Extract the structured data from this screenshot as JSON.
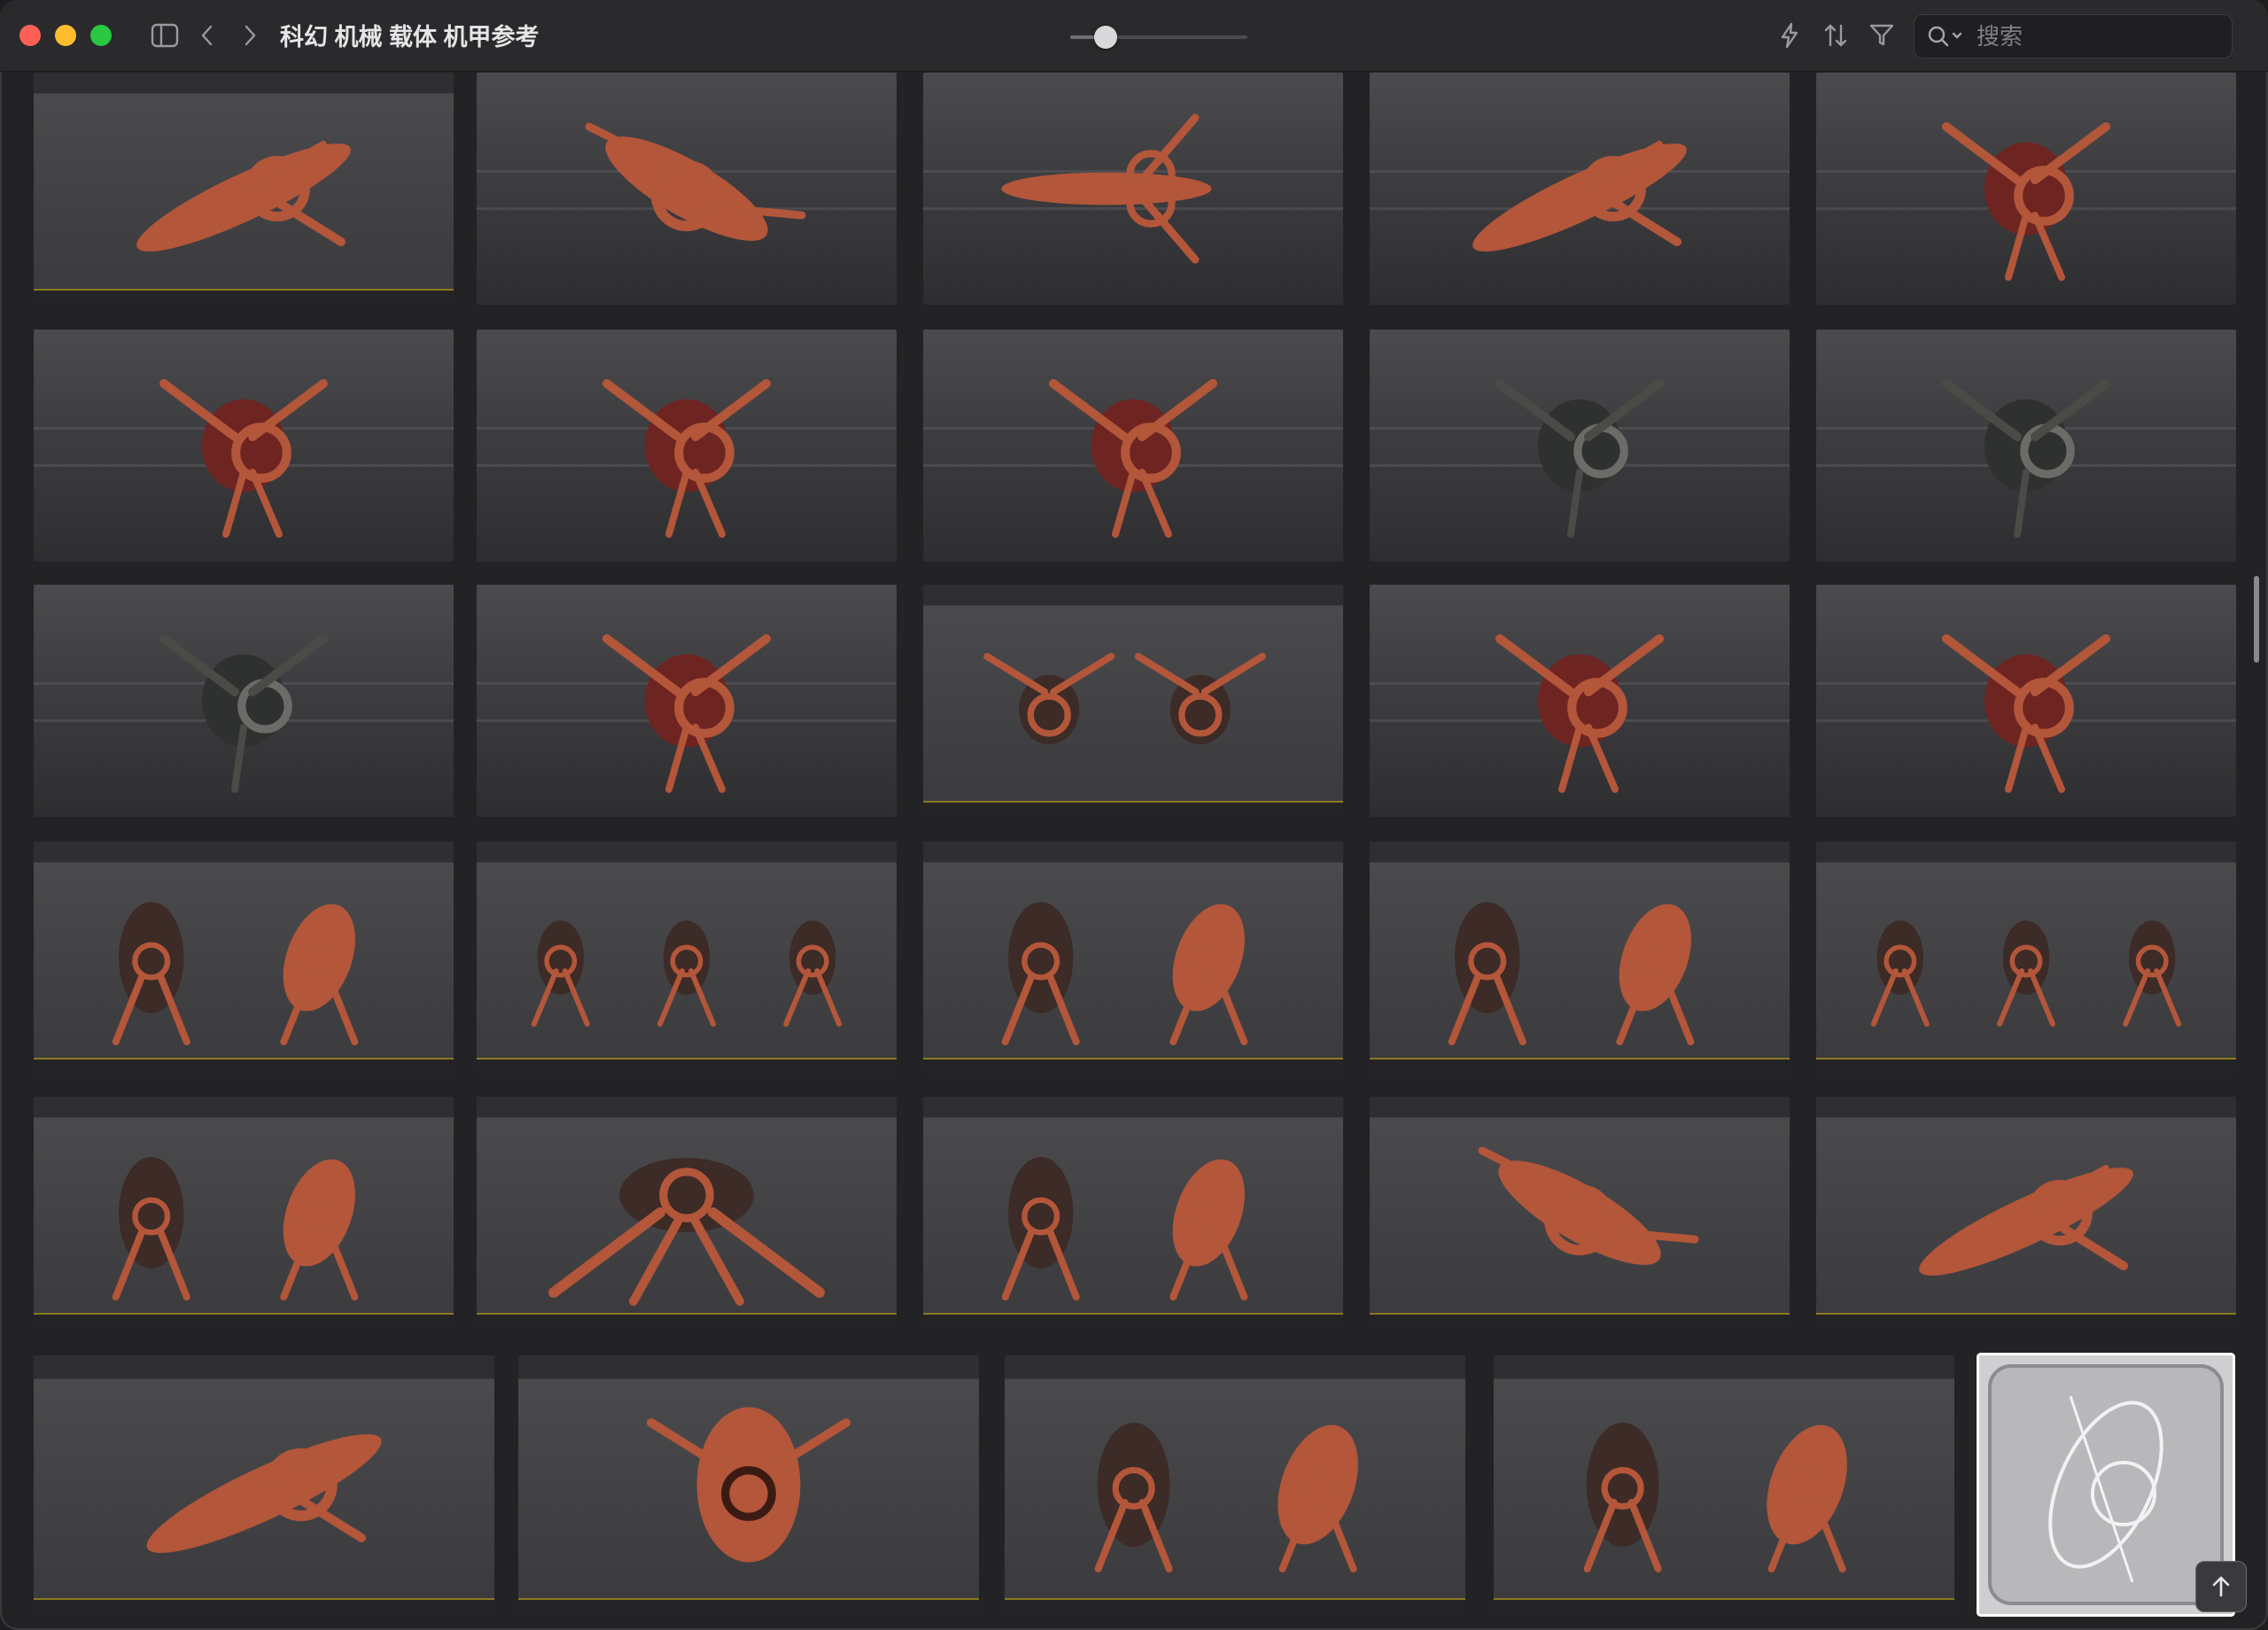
{
  "window": {
    "title": "科幻 机械 载体 机甲参考"
  },
  "toolbar": {
    "sidebar_icon": "sidebar-icon",
    "back_icon": "chevron-left-icon",
    "forward_icon": "chevron-right-icon",
    "zoom_slider_value": 0.15,
    "quick_action_icon": "lightning-icon",
    "sort_icon": "sort-icon",
    "filter_icon": "filter-icon"
  },
  "search": {
    "placeholder": "搜索",
    "value": ""
  },
  "colors": {
    "close": "#fe5f57",
    "minimize": "#febc2e",
    "maximize": "#28c840",
    "thumb_body": "#b3563a"
  },
  "grid": {
    "rows": [
      {
        "items": [
          {
            "name": "thumb-r1-c1",
            "kind": "sheet",
            "shape": "ship-side"
          },
          {
            "name": "thumb-r1-c2",
            "kind": "render",
            "shape": "ship-diag"
          },
          {
            "name": "thumb-r1-c3",
            "kind": "render",
            "shape": "ship-top"
          },
          {
            "name": "thumb-r1-c4",
            "kind": "render",
            "shape": "ship-side"
          },
          {
            "name": "thumb-r1-c5",
            "kind": "render",
            "shape": "bug-red"
          }
        ]
      },
      {
        "items": [
          {
            "name": "thumb-r2-c1",
            "kind": "render",
            "shape": "bug-red"
          },
          {
            "name": "thumb-r2-c2",
            "kind": "render",
            "shape": "bug-red"
          },
          {
            "name": "thumb-r2-c3",
            "kind": "render",
            "shape": "bug-red"
          },
          {
            "name": "thumb-r2-c4",
            "kind": "render",
            "shape": "bug-dark"
          },
          {
            "name": "thumb-r2-c5",
            "kind": "render",
            "shape": "bug-dark"
          }
        ]
      },
      {
        "items": [
          {
            "name": "thumb-r3-c1",
            "kind": "render",
            "shape": "bug-dark"
          },
          {
            "name": "thumb-r3-c2",
            "kind": "render",
            "shape": "bug-red"
          },
          {
            "name": "thumb-r3-c3",
            "kind": "sheet",
            "shape": "bug-pair"
          },
          {
            "name": "thumb-r3-c4",
            "kind": "render",
            "shape": "bug-red"
          },
          {
            "name": "thumb-r3-c5",
            "kind": "render",
            "shape": "bug-red"
          }
        ]
      },
      {
        "items": [
          {
            "name": "thumb-r4-c1",
            "kind": "sheet",
            "shape": "mech-pair"
          },
          {
            "name": "thumb-r4-c2",
            "kind": "sheet",
            "shape": "mech-trio"
          },
          {
            "name": "thumb-r4-c3",
            "kind": "sheet",
            "shape": "mech-pair"
          },
          {
            "name": "thumb-r4-c4",
            "kind": "sheet",
            "shape": "mech-pair"
          },
          {
            "name": "thumb-r4-c5",
            "kind": "sheet",
            "shape": "mech-trio"
          }
        ]
      },
      {
        "items": [
          {
            "name": "thumb-r5-c1",
            "kind": "sheet",
            "shape": "mech-pair"
          },
          {
            "name": "thumb-r5-c2",
            "kind": "sheet",
            "shape": "walker"
          },
          {
            "name": "thumb-r5-c3",
            "kind": "sheet",
            "shape": "mech-pair"
          },
          {
            "name": "thumb-r5-c4",
            "kind": "sheet",
            "shape": "ship-diag"
          },
          {
            "name": "thumb-r5-c5",
            "kind": "sheet",
            "shape": "ship-side"
          }
        ]
      },
      {
        "items": [
          {
            "name": "thumb-r6-c1",
            "kind": "sheet",
            "shape": "ship-side"
          },
          {
            "name": "thumb-r6-c2",
            "kind": "sheet",
            "shape": "mech-front"
          },
          {
            "name": "thumb-r6-c3",
            "kind": "sheet",
            "shape": "mech-pair"
          },
          {
            "name": "thumb-r6-c4",
            "kind": "sheet",
            "shape": "mech-pair"
          },
          {
            "name": "thumb-r6-c5",
            "kind": "wire",
            "shape": "wireframe"
          }
        ]
      }
    ]
  },
  "scroll_top_icon": "arrow-up-icon"
}
